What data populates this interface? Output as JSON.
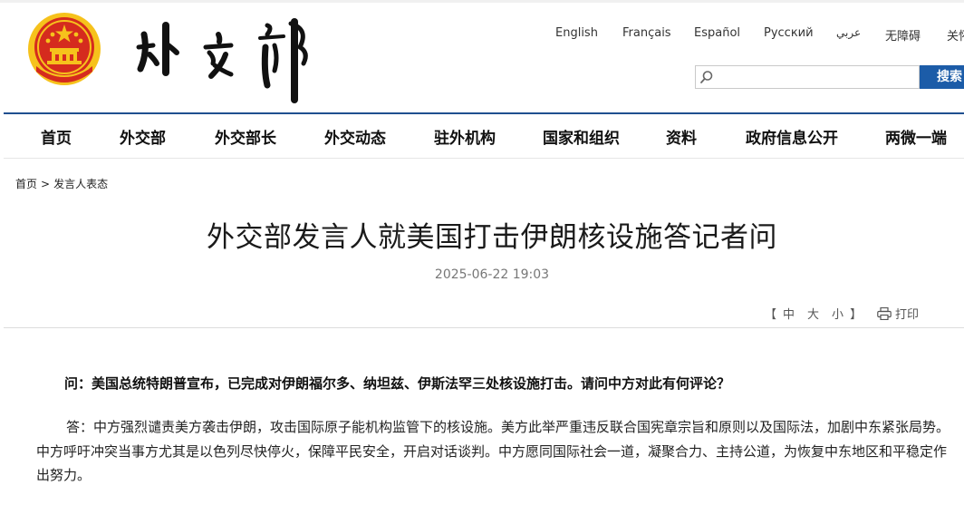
{
  "header": {
    "site_title_calligraphy": "外交部",
    "languages": [
      "English",
      "Français",
      "Español",
      "Русский",
      "عربي",
      "无障碍",
      "关怀版"
    ],
    "search": {
      "placeholder": "",
      "button_label": "搜索"
    }
  },
  "nav": {
    "items": [
      "首页",
      "外交部",
      "外交部长",
      "外交动态",
      "驻外机构",
      "国家和组织",
      "资料",
      "政府信息公开",
      "两微一端"
    ]
  },
  "breadcrumb": {
    "home": "首页",
    "separator": ">",
    "current": "发言人表态"
  },
  "article": {
    "title": "外交部发言人就美国打击伊朗核设施答记者问",
    "date": "2025-06-22 19:03",
    "font_size": {
      "open": "【",
      "small": "中",
      "medium": "大",
      "large": "小",
      "close": "】"
    },
    "print_label": "打印",
    "question": "问：美国总统特朗普宣布，已完成对伊朗福尔多、纳坦兹、伊斯法罕三处核设施打击。请问中方对此有何评论？",
    "answer": "答：中方强烈谴责美方袭击伊朗，攻击国际原子能机构监管下的核设施。美方此举严重违反联合国宪章宗旨和原则以及国际法，加剧中东紧张局势。中方呼吁冲突当事方尤其是以色列尽快停火，保障平民安全，开启对话谈判。中方愿同国际社会一道，凝聚合力、主持公道，为恢复中东地区和平稳定作出努力。"
  },
  "colors": {
    "brand_blue": "#1c5ca8",
    "nav_rule": "#1f4f8f",
    "emblem_red": "#d52b1e",
    "emblem_gold": "#f6c21c"
  }
}
